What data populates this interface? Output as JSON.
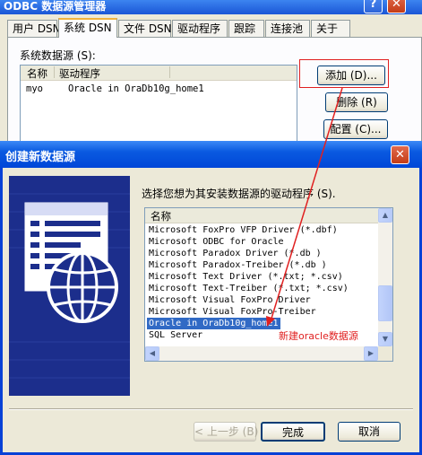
{
  "odbc": {
    "title": "ODBC 数据源管理器",
    "help_btn": "?",
    "close_btn": "✕",
    "tabs": [
      "用户 DSN",
      "系统 DSN",
      "文件 DSN",
      "驱动程序",
      "跟踪",
      "连接池",
      "关于"
    ],
    "system_dsn_label": "系统数据源 (S):",
    "list_headers": [
      "名称",
      "驱动程序"
    ],
    "list_rows": [
      {
        "name": "myo",
        "driver": "Oracle in OraDb10g_home1"
      }
    ],
    "buttons": {
      "add": "添加 (D)...",
      "remove": "删除 (R)",
      "configure": "配置 (C)..."
    }
  },
  "dialog": {
    "title": "创建新数据源",
    "close_btn": "✕",
    "prompt": "选择您想为其安装数据源的驱动程序 (S).",
    "list_header": "名称",
    "drivers": [
      "Microsoft FoxPro VFP Driver (*.dbf)",
      "Microsoft ODBC for Oracle",
      "Microsoft Paradox Driver (*.db )",
      "Microsoft Paradox-Treiber (*.db )",
      "Microsoft Text Driver (*.txt; *.csv)",
      "Microsoft Text-Treiber (*.txt; *.csv)",
      "Microsoft Visual FoxPro Driver",
      "Microsoft Visual FoxPro-Treiber",
      "Oracle in OraDb10g_home1",
      "SQL Server"
    ],
    "selected_index": 8,
    "annotation": "新建oracle数据源",
    "buttons": {
      "back": "< 上一步 (B)",
      "finish": "完成",
      "cancel": "取消"
    },
    "scroll_up": "▲",
    "scroll_down": "▼",
    "scroll_left": "◀",
    "scroll_right": "▶"
  },
  "colors": {
    "annotation": "#e02020",
    "selection": "#316ac5",
    "title_blue": "#0a5ae0"
  }
}
